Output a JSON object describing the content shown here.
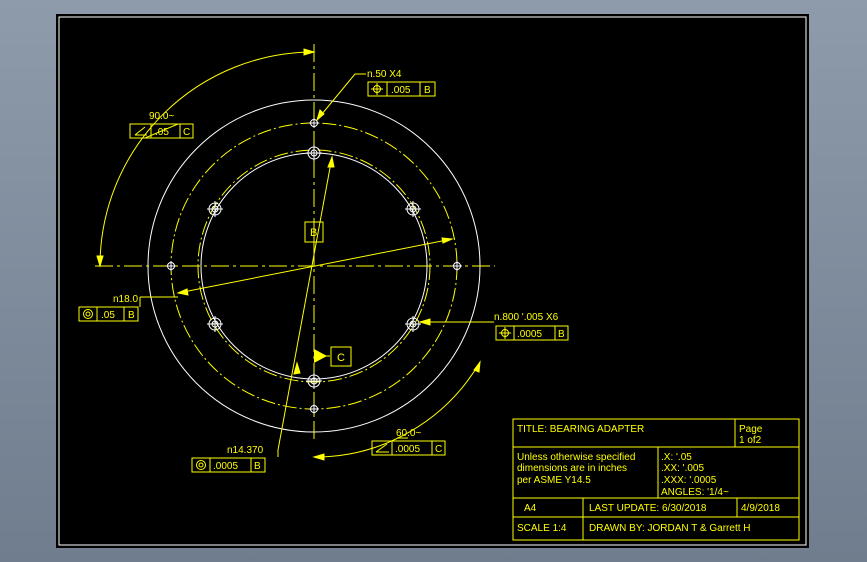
{
  "colors": {
    "line": "#ffff00",
    "geometry": "#ffffff",
    "background": "#000000",
    "bezel": "#7f8c9d"
  },
  "callouts": {
    "hole_small": {
      "label": "n.50 X4",
      "fcf_value": ".005",
      "fcf_datum": "B",
      "fcf_symbol": "position-icon"
    },
    "angle_90": {
      "label": "90.0~",
      "fcf_value": ".05",
      "fcf_datum": "C",
      "fcf_symbol": "angularity-icon"
    },
    "inner_dia": {
      "label": "n18.0",
      "fcf_value": ".05",
      "fcf_datum": "B",
      "fcf_symbol": "concentricity-icon"
    },
    "hole_large": {
      "label": "n.800 '.005 X6",
      "fcf_value": ".0005",
      "fcf_datum": "B",
      "fcf_symbol": "position-icon"
    },
    "outer_dia": {
      "label": "n14.370",
      "fcf_value": ".0005",
      "fcf_datum": "B",
      "fcf_symbol": "concentricity-icon"
    },
    "angle_60": {
      "label": "60.0~",
      "fcf_value": ".0005",
      "fcf_datum": "C",
      "fcf_symbol": "angularity-icon"
    }
  },
  "datums": {
    "b": "B",
    "c": "C"
  },
  "title_block": {
    "title": "TITLE: BEARING ADAPTER",
    "page_label": "Page",
    "page_value": "1 of2",
    "notes": [
      "Unless otherwise specified",
      "dimensions are in inches",
      "per ASME Y14.5"
    ],
    "tolerances": [
      ".X: '.05",
      ".XX: '.005",
      ".XXX: '.0005",
      "ANGLES: '1/4~"
    ],
    "size": "A4",
    "last_update": "LAST UPDATE: 6/30/2018",
    "date": "4/9/2018",
    "scale": "SCALE 1:4",
    "drawn_by": "DRAWN BY: JORDAN T & Garrett H"
  }
}
